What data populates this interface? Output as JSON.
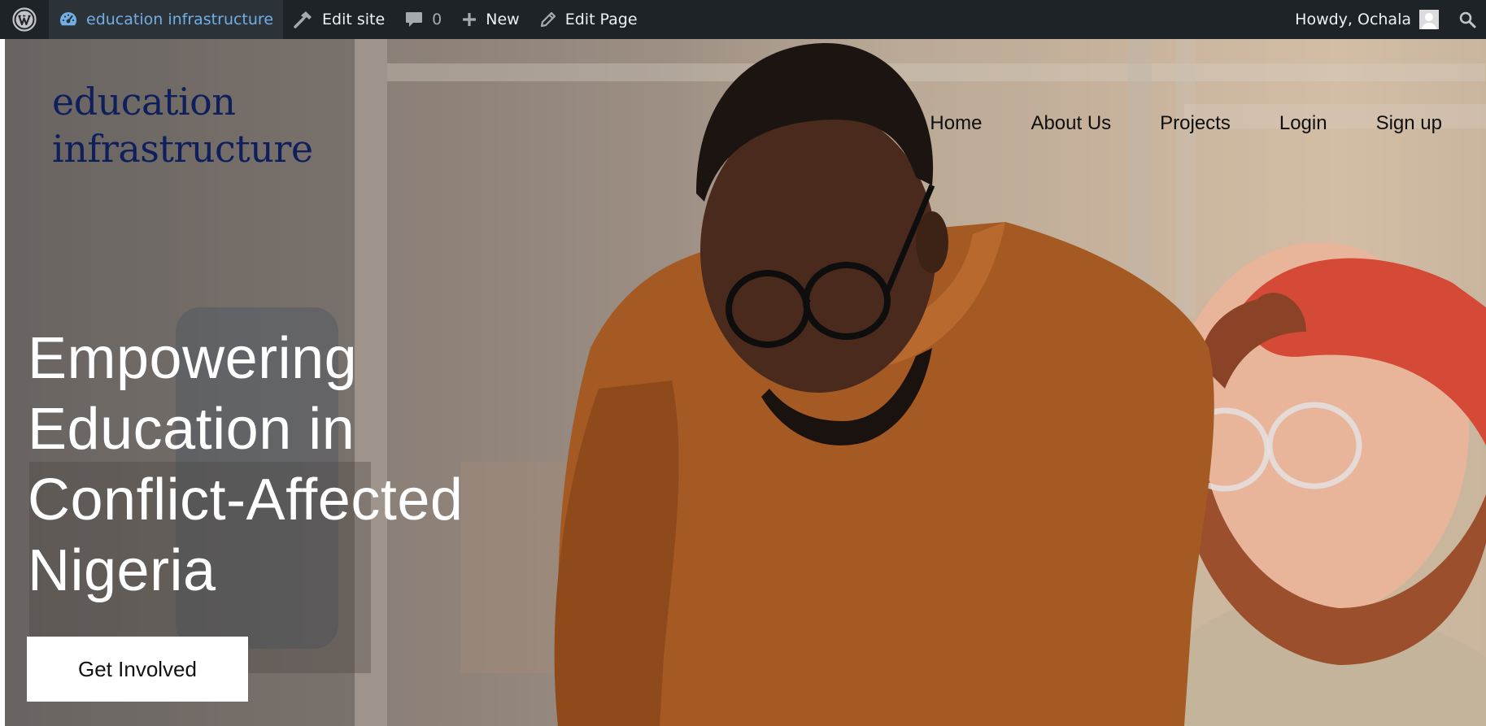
{
  "admin_bar": {
    "wp_logo_icon": "wordpress-logo-icon",
    "site_name": "education infrastructure",
    "edit_site_label": "Edit site",
    "comments_count": "0",
    "new_label": "New",
    "edit_page_label": "Edit Page",
    "howdy_label": "Howdy, Ochala",
    "colors": {
      "background": "#1d2327",
      "site_link": "#72aee6",
      "text": "#f0f0f1"
    }
  },
  "site": {
    "title": "education infrastructure",
    "title_color": "#0f1f5c"
  },
  "nav": {
    "items": [
      {
        "label": "Home"
      },
      {
        "label": "About Us"
      },
      {
        "label": "Projects"
      },
      {
        "label": "Login"
      },
      {
        "label": "Sign up"
      }
    ]
  },
  "hero": {
    "headline": "Empowering Education in Conflict-Affected Nigeria",
    "cta_label": "Get Involved",
    "image_subject": "photo-two-men-looking-at-screen"
  }
}
